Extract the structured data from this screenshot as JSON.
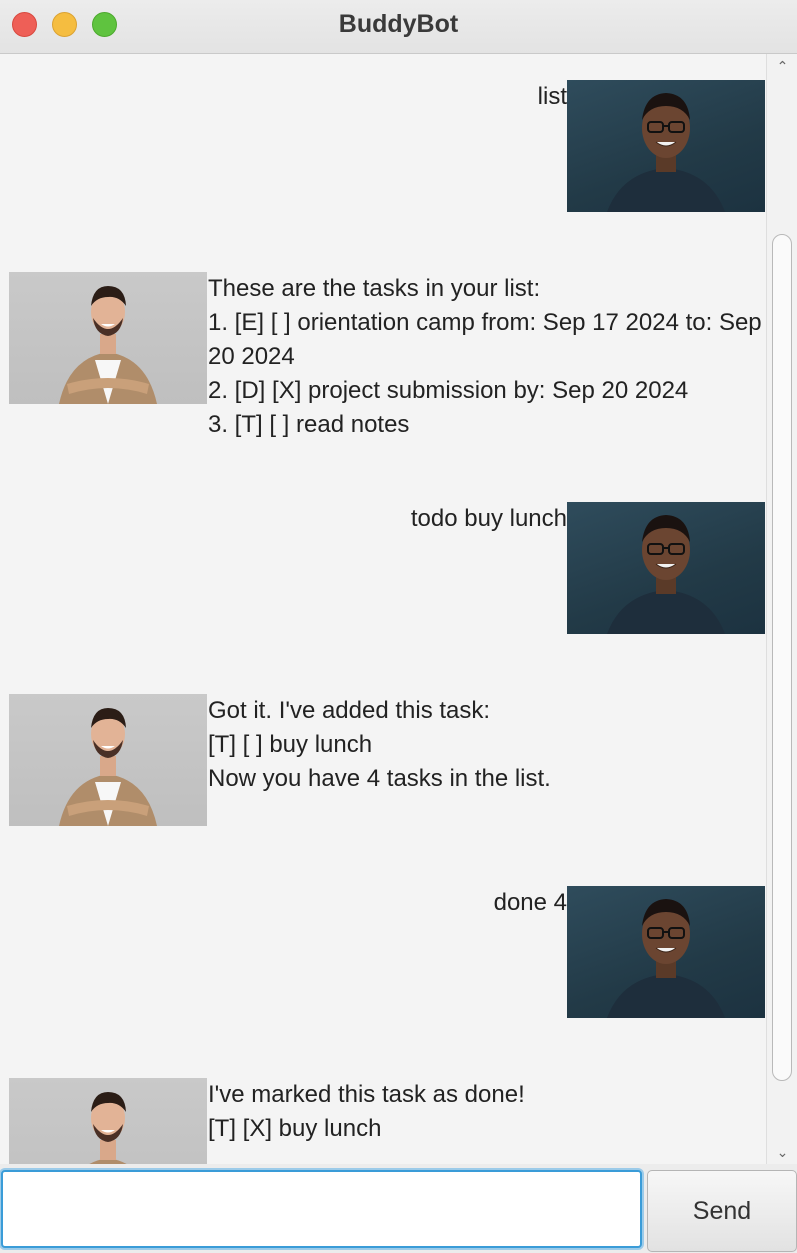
{
  "window": {
    "title": "BuddyBot"
  },
  "chat": {
    "messages": [
      {
        "sender": "user",
        "text": "list"
      },
      {
        "sender": "bot",
        "text": "These are the tasks in your list:\n1. [E] [ ] orientation camp from: Sep 17 2024 to: Sep\n20 2024\n2. [D] [X] project submission by: Sep 20 2024\n3. [T] [ ] read notes"
      },
      {
        "sender": "user",
        "text": "todo buy lunch"
      },
      {
        "sender": "bot",
        "text": "Got it. I've added this task:\n[T] [ ] buy lunch\nNow you have 4 tasks in the list."
      },
      {
        "sender": "user",
        "text": "done 4"
      },
      {
        "sender": "bot",
        "text": "I've marked this task as done!\n[T] [X] buy lunch"
      }
    ]
  },
  "input": {
    "value": "",
    "placeholder": ""
  },
  "send_label": "Send",
  "colors": {
    "input_focus": "#3a9cd8",
    "user_avatar_bg": "#2f4c5c",
    "bot_avatar_bg": "#c4c4c4"
  }
}
